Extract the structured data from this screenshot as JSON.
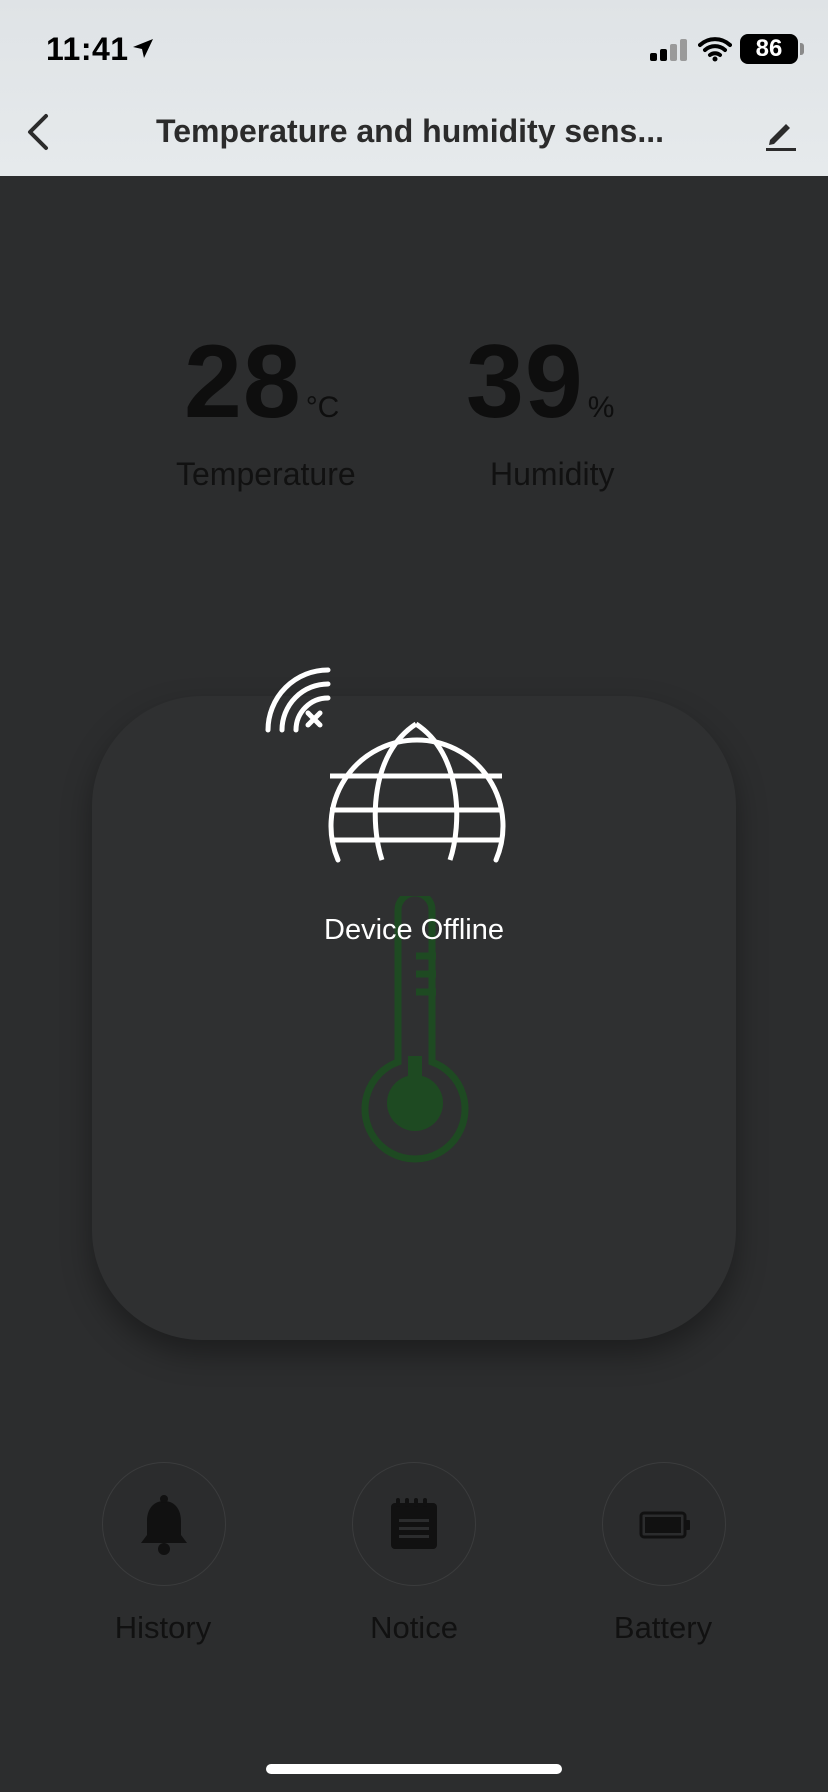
{
  "status_bar": {
    "time": "11:41",
    "battery": "86",
    "icons": [
      "location-arrow-icon",
      "cellular-signal-icon",
      "wifi-icon",
      "battery-icon"
    ]
  },
  "nav": {
    "title": "Temperature and humidity sens...",
    "icons": [
      "chevron-left-icon",
      "pencil-icon"
    ]
  },
  "readings": {
    "temperature": {
      "value": "28",
      "unit": "°C",
      "label": "Temperature"
    },
    "humidity": {
      "value": "39",
      "unit": "%",
      "label": "Humidity"
    }
  },
  "offline": {
    "message": "Device Offline",
    "icons": [
      "wifi-off-icon",
      "globe-icon"
    ]
  },
  "card": {
    "icon": "thermometer-icon",
    "accent": "#1e5a22"
  },
  "actions": [
    {
      "label": "History",
      "icon": "bell-icon"
    },
    {
      "label": "Notice",
      "icon": "notepad-icon"
    },
    {
      "label": "Battery",
      "icon": "battery-icon"
    }
  ]
}
